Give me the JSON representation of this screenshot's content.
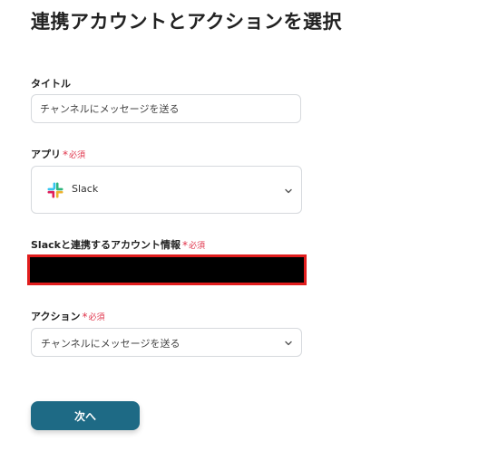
{
  "header": {
    "title": "連携アカウントとアクションを選択"
  },
  "form": {
    "title_field": {
      "label": "タイトル",
      "value": "チャンネルにメッセージを送る"
    },
    "app_field": {
      "label": "アプリ",
      "required_mark": "*",
      "required_text": "必須",
      "selected_app": "Slack",
      "icon": "slack-logo-icon"
    },
    "account_field": {
      "label": "Slackと連携するアカウント情報",
      "required_mark": "*",
      "required_text": "必須",
      "value_redacted": true
    },
    "action_field": {
      "label": "アクション",
      "required_mark": "*",
      "required_text": "必須",
      "selected_action": "チャンネルにメッセージを送る"
    }
  },
  "buttons": {
    "next_label": "次へ"
  },
  "colors": {
    "primary_button": "#1e6a85",
    "required": "#e0344b",
    "redaction_border": "#e11d1d",
    "input_border": "#d6d9dd"
  }
}
